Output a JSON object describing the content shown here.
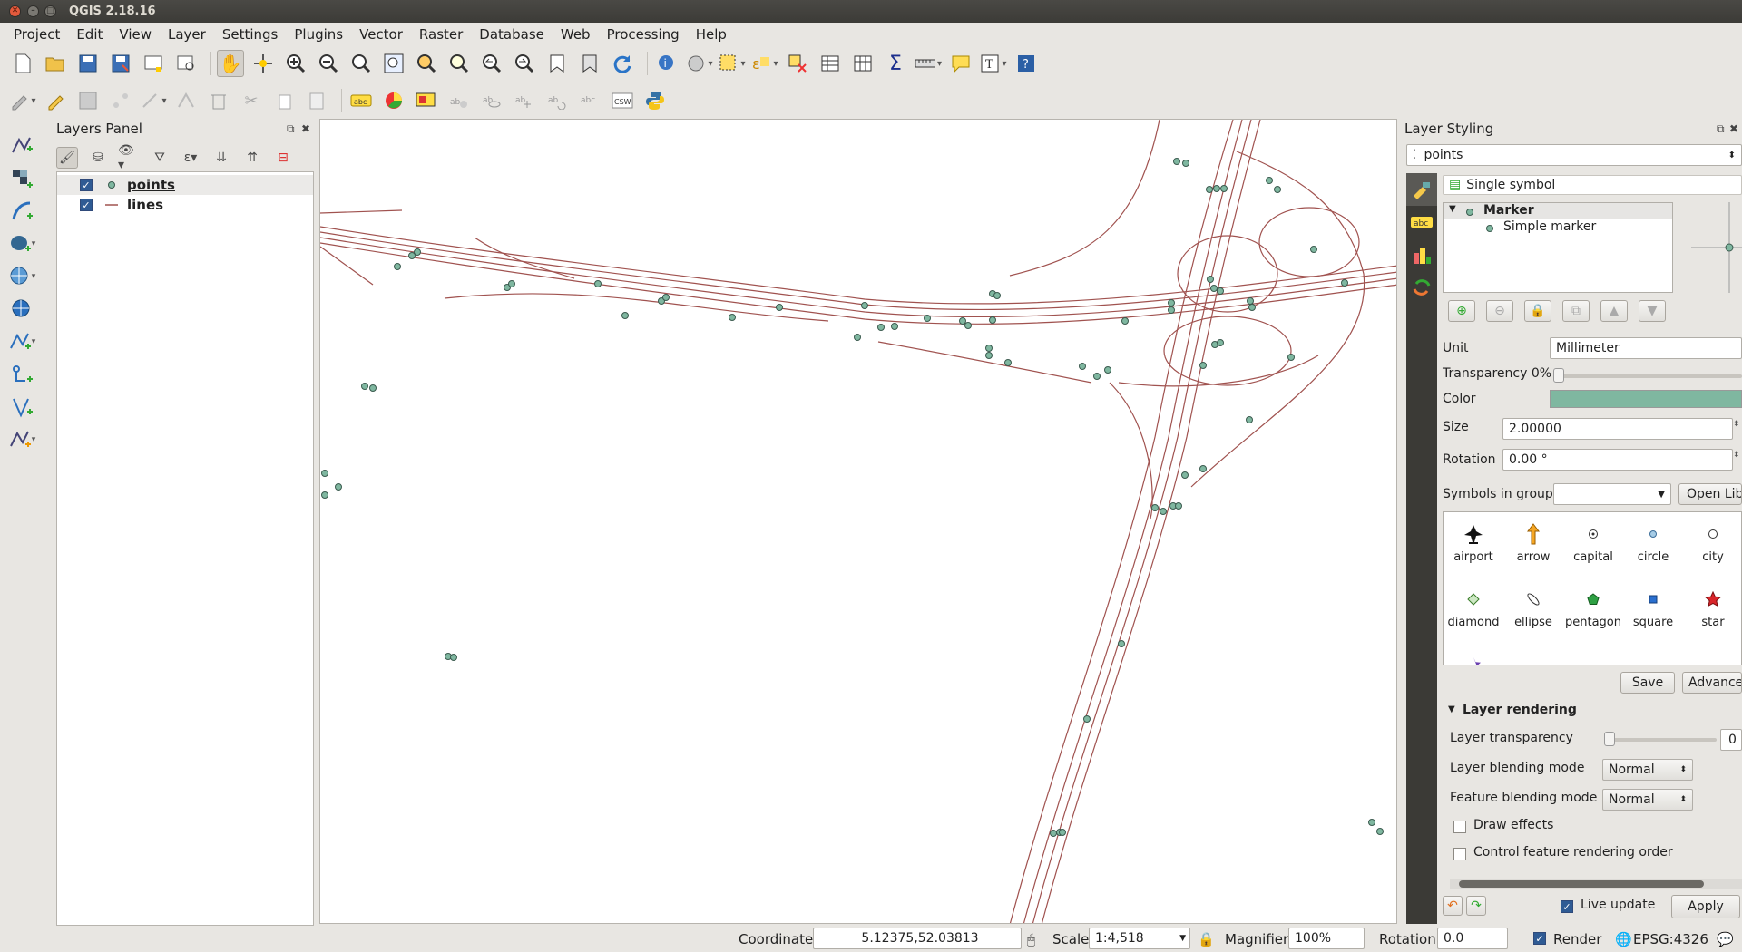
{
  "window": {
    "title": "QGIS 2.18.16"
  },
  "menu": [
    "Project",
    "Edit",
    "View",
    "Layer",
    "Settings",
    "Plugins",
    "Vector",
    "Raster",
    "Database",
    "Web",
    "Processing",
    "Help"
  ],
  "layers_panel": {
    "title": "Layers Panel",
    "layers": [
      {
        "name": "points",
        "checked": true,
        "selected": true
      },
      {
        "name": "lines",
        "checked": true,
        "selected": false
      }
    ]
  },
  "layer_styling": {
    "title": "Layer Styling",
    "layer_select": "points",
    "renderer": "Single symbol",
    "tree": {
      "root": "Marker",
      "child": "Simple marker"
    },
    "unit_label": "Unit",
    "unit_value": "Millimeter",
    "transparency_label": "Transparency 0%",
    "color_label": "Color",
    "color_value": "#7fb7a0",
    "size_label": "Size",
    "size_value": "2.00000",
    "rotation_label": "Rotation",
    "rotation_value": "0.00 °",
    "symbols_group_label": "Symbols in group",
    "open_lib_label": "Open Lib",
    "symbols": [
      "airport",
      "arrow",
      "capital",
      "circle",
      "city",
      "diamond",
      "ellipse",
      "pentagon",
      "square",
      "star"
    ],
    "save_label": "Save",
    "advanced_label": "Advance",
    "layer_rendering_label": "Layer rendering",
    "layer_transparency_label": "Layer transparency",
    "layer_transparency_value": "0",
    "layer_blending_label": "Layer blending mode",
    "layer_blending_value": "Normal",
    "feature_blending_label": "Feature blending mode",
    "feature_blending_value": "Normal",
    "draw_effects_label": "Draw effects",
    "control_order_label": "Control feature rendering order",
    "live_update_label": "Live update",
    "apply_label": "Apply"
  },
  "statusbar": {
    "coordinate_label": "Coordinate",
    "coordinate_value": "5.12375,52.03813",
    "scale_label": "Scale",
    "scale_value": "1:4,518",
    "magnifier_label": "Magnifier",
    "magnifier_value": "100%",
    "rotation_label": "Rotation",
    "rotation_value": "0.0",
    "render_label": "Render",
    "crs_label": "EPSG:4326"
  },
  "colors": {
    "line": "#a0524f",
    "point_fill": "#7fb7a0",
    "point_stroke": "#3a5a4e"
  }
}
